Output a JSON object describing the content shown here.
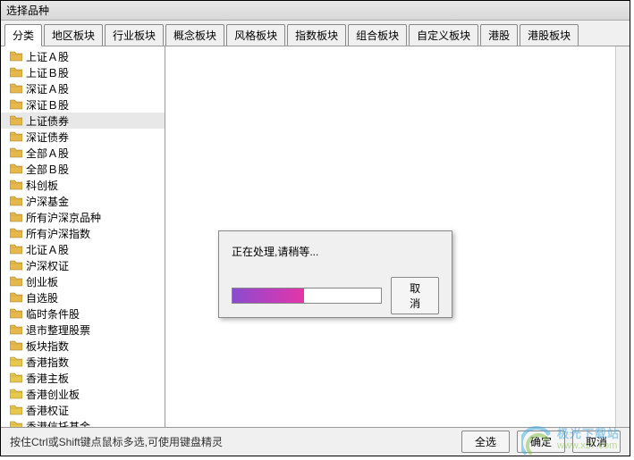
{
  "window": {
    "title": "选择品种"
  },
  "tabs": [
    {
      "label": "分类",
      "active": true
    },
    {
      "label": "地区板块"
    },
    {
      "label": "行业板块"
    },
    {
      "label": "概念板块"
    },
    {
      "label": "风格板块"
    },
    {
      "label": "指数板块"
    },
    {
      "label": "组合板块"
    },
    {
      "label": "自定义板块"
    },
    {
      "label": "港股"
    },
    {
      "label": "港股板块"
    }
  ],
  "tree": [
    {
      "label": "上证Ａ股",
      "color": "#e6b84a"
    },
    {
      "label": "上证Ｂ股",
      "color": "#e6b84a"
    },
    {
      "label": "深证Ａ股",
      "color": "#e6b84a"
    },
    {
      "label": "深证Ｂ股",
      "color": "#e6b84a"
    },
    {
      "label": "上证债券",
      "color": "#e6b84a",
      "selected": true
    },
    {
      "label": "深证债券",
      "color": "#e6b84a"
    },
    {
      "label": "全部Ａ股",
      "color": "#e6b84a"
    },
    {
      "label": "全部Ｂ股",
      "color": "#e6b84a"
    },
    {
      "label": "科创板",
      "color": "#e6b84a"
    },
    {
      "label": "沪深基金",
      "color": "#e6b84a"
    },
    {
      "label": "所有沪深京品种",
      "color": "#e6b84a"
    },
    {
      "label": "所有沪深指数",
      "color": "#e6b84a"
    },
    {
      "label": "北证Ａ股",
      "color": "#e6b84a"
    },
    {
      "label": "沪深权证",
      "color": "#e6b84a"
    },
    {
      "label": "创业板",
      "color": "#e6b84a"
    },
    {
      "label": "自选股",
      "color": "#e6b84a"
    },
    {
      "label": "临时条件股",
      "color": "#e6b84a"
    },
    {
      "label": "退市整理股票",
      "color": "#e6b84a"
    },
    {
      "label": "板块指数",
      "color": "#e6b84a"
    },
    {
      "label": "香港指数",
      "color": "#e6c94a"
    },
    {
      "label": "香港主板",
      "color": "#e6c94a"
    },
    {
      "label": "香港创业板",
      "color": "#e6c94a"
    },
    {
      "label": "香港权证",
      "color": "#e6c94a"
    },
    {
      "label": "香港信托基金",
      "color": "#e6c94a"
    }
  ],
  "footer": {
    "hint": "按住Ctrl或Shift键点鼠标多选,可使用键盘精灵",
    "select_all": "全选",
    "ok": "确定",
    "cancel": "取消"
  },
  "progress": {
    "message": "正在处理,请稍等...",
    "cancel": "取消",
    "percent": 48
  },
  "watermark": {
    "line1": "极光下载站",
    "line2": "www.xz7.com"
  }
}
